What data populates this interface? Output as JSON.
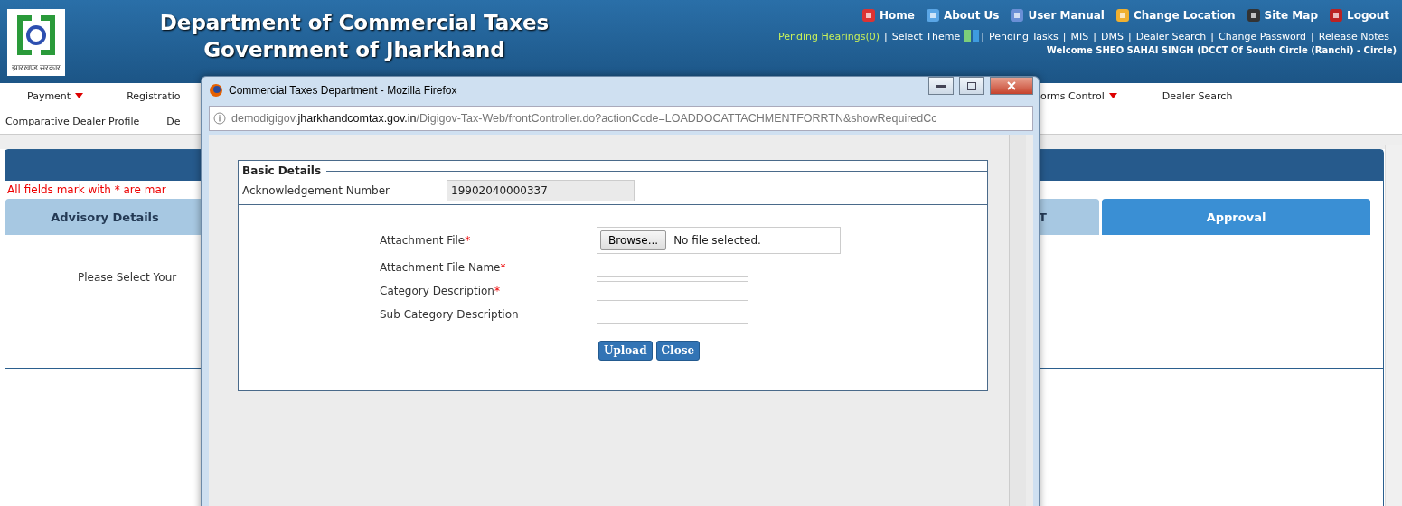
{
  "header": {
    "title_lines": [
      "Department of Commercial Taxes",
      "Government of Jharkhand"
    ],
    "logo_caption": "झारखण्ड सरकार",
    "top_links": [
      "Home",
      "About Us",
      "User Manual",
      "Change Location",
      "Site Map",
      "Logout"
    ],
    "nav_row": [
      {
        "kind": "pending",
        "text": "Pending Hearings(0)"
      },
      {
        "kind": "separator",
        "text": "|"
      },
      {
        "kind": "label",
        "text": "Select Theme"
      },
      {
        "kind": "swatch",
        "color": "#7ccf7a"
      },
      {
        "kind": "swatch",
        "color": "#3e9be0"
      },
      {
        "kind": "separator",
        "text": "|"
      },
      {
        "kind": "link",
        "text": "Pending Tasks"
      },
      {
        "kind": "separator",
        "text": "|"
      },
      {
        "kind": "link",
        "text": "MIS"
      },
      {
        "kind": "separator",
        "text": "|"
      },
      {
        "kind": "link",
        "text": "DMS"
      },
      {
        "kind": "separator",
        "text": "|"
      },
      {
        "kind": "link",
        "text": "Dealer Search"
      },
      {
        "kind": "separator",
        "text": "|"
      },
      {
        "kind": "link",
        "text": "Change Password"
      },
      {
        "kind": "separator",
        "text": "|"
      },
      {
        "kind": "link",
        "text": "Release Notes"
      }
    ],
    "welcome": "Welcome SHEO SAHAI SINGH (DCCT Of South Circle (Ranchi) - Circle)"
  },
  "menu": {
    "row_1_left": [
      {
        "label": "Payment",
        "dropdown": true
      },
      {
        "label": "Registratio",
        "dropdown": false
      }
    ],
    "row_1_right": [
      {
        "label": "orms Control",
        "dropdown": true
      },
      {
        "label": "Dealer Search",
        "dropdown": false
      }
    ],
    "row_2_left": [
      "Comparative Dealer Profile",
      "De"
    ]
  },
  "content": {
    "notice": "All fields mark with * are mar",
    "tabs": [
      {
        "label": "Advisory Details",
        "selected": false
      },
      {
        "label": "T",
        "selected": false
      },
      {
        "label": "Approval",
        "selected": true
      }
    ],
    "prompt": "Please Select Your"
  },
  "popup": {
    "title": "Commercial Taxes Department - Mozilla Firefox",
    "url_prefix": "demodigigov.",
    "url_domain": "jharkhandcomtax.gov.in",
    "url_rest": "/Digigov-Tax-Web/frontController.do?actionCode=LOADDOCATTACHMENTFORRTN&showRequiredCc",
    "fieldset": {
      "legend": "Basic Details",
      "label": "Acknowledgement Number",
      "value": "19902040000337"
    },
    "fields": [
      {
        "kind": "file",
        "label": "Attachment File",
        "required_mark": "*",
        "button": "Browse...",
        "value": "No file selected."
      },
      {
        "kind": "text",
        "label": "Attachment File Name",
        "required_mark": "*"
      },
      {
        "kind": "text",
        "label": "Category Description",
        "required_mark": "*"
      },
      {
        "kind": "text",
        "label": "Sub Category Description"
      }
    ],
    "buttons": [
      "Upload",
      "Close"
    ]
  }
}
